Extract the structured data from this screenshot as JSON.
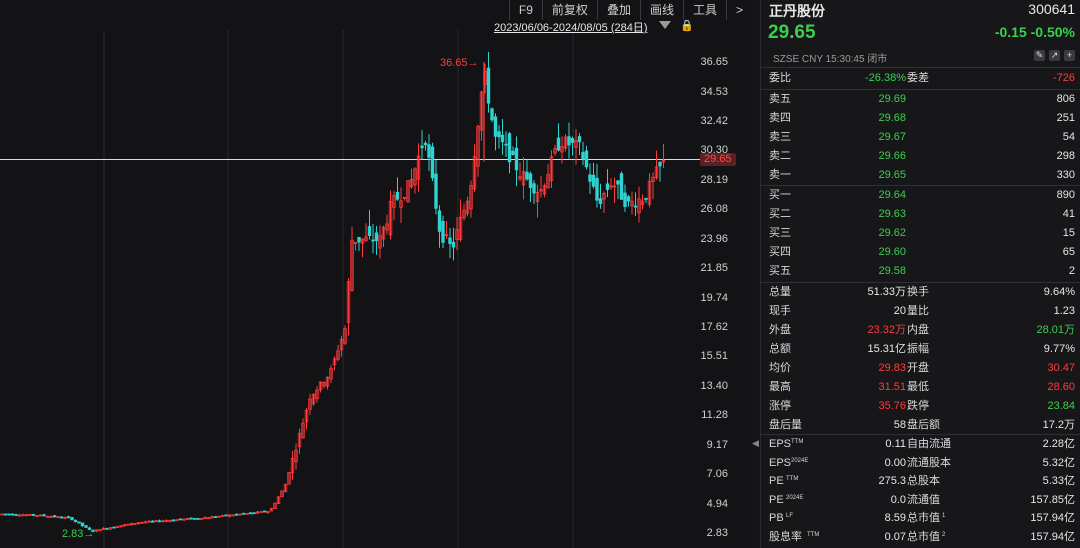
{
  "toolbar": {
    "items": [
      "F9",
      "前复权",
      "叠加",
      "画线",
      "工具",
      ">"
    ]
  },
  "range_label": "2023/06/06-2024/08/05 (284日)",
  "current_price_badge": "29.65",
  "max_label": "36.65",
  "min_label": "2.83",
  "chart_data": {
    "type": "candlestick",
    "title": "",
    "y_ticks": [
      "36.65",
      "34.53",
      "32.42",
      "30.30",
      "28.19",
      "26.08",
      "23.96",
      "21.85",
      "19.74",
      "17.62",
      "15.51",
      "13.40",
      "11.28",
      "9.17",
      "7.06",
      "4.94",
      "2.83"
    ],
    "ylim": [
      2.83,
      36.65
    ],
    "x_range": [
      "2023/06/06",
      "2024/08/05"
    ],
    "trading_days": 284,
    "max_marker": 36.65,
    "min_marker": 2.83,
    "current_price_line": 29.65,
    "colors": {
      "up": "#ff3b3b",
      "down": "#2fd3cf",
      "grid": "#2a2a30",
      "price_line": "#dcdcdc"
    }
  },
  "stock": {
    "name": "正丹股份",
    "code": "300641",
    "price": "29.65",
    "change": "-0.15",
    "change_pct": "-0.50%",
    "meta": "SZSE  CNY  15:30:45  闭市"
  },
  "committee": {
    "l1": "委比",
    "v1": "-26.38%",
    "l2": "委差",
    "v2": "-726"
  },
  "asks": [
    {
      "label": "卖五",
      "price": "29.69",
      "vol": "806"
    },
    {
      "label": "卖四",
      "price": "29.68",
      "vol": "251"
    },
    {
      "label": "卖三",
      "price": "29.67",
      "vol": "54"
    },
    {
      "label": "卖二",
      "price": "29.66",
      "vol": "298"
    },
    {
      "label": "卖一",
      "price": "29.65",
      "vol": "330"
    }
  ],
  "bids": [
    {
      "label": "买一",
      "price": "29.64",
      "vol": "890"
    },
    {
      "label": "买二",
      "price": "29.63",
      "vol": "41"
    },
    {
      "label": "买三",
      "price": "29.62",
      "vol": "15"
    },
    {
      "label": "买四",
      "price": "29.60",
      "vol": "65"
    },
    {
      "label": "买五",
      "price": "29.58",
      "vol": "2"
    }
  ],
  "stats": [
    {
      "l1": "总量",
      "v1": "51.33万",
      "c1": "white",
      "l2": "换手",
      "v2": "9.64%",
      "c2": "white"
    },
    {
      "l1": "现手",
      "v1": "20",
      "c1": "white",
      "l2": "量比",
      "v2": "1.23",
      "c2": "white"
    },
    {
      "l1": "外盘",
      "v1": "23.32万",
      "c1": "red",
      "l2": "内盘",
      "v2": "28.01万",
      "c2": "green"
    },
    {
      "l1": "总额",
      "v1": "15.31亿",
      "c1": "white",
      "l2": "振幅",
      "v2": "9.77%",
      "c2": "white"
    },
    {
      "l1": "均价",
      "v1": "29.83",
      "c1": "red",
      "l2": "开盘",
      "v2": "30.47",
      "c2": "red"
    },
    {
      "l1": "最高",
      "v1": "31.51",
      "c1": "red",
      "l2": "最低",
      "v2": "28.60",
      "c2": "red"
    },
    {
      "l1": "涨停",
      "v1": "35.76",
      "c1": "red",
      "l2": "跌停",
      "v2": "23.84",
      "c2": "green"
    },
    {
      "l1": "盘后量",
      "v1": "58",
      "c1": "white",
      "l2": "盘后额",
      "v2": "17.2万",
      "c2": "white"
    }
  ],
  "fundamentals": [
    {
      "l1": "EPS",
      "sup": "TTM",
      "v1": "0.11",
      "l2": "自由流通",
      "sup2": "",
      "v2": "2.28亿"
    },
    {
      "l1": "EPS",
      "sup": "2024E",
      "v1": "0.00",
      "l2": "流通股本",
      "sup2": "",
      "v2": "5.32亿"
    },
    {
      "l1": "PE",
      "sup": "TTM",
      "v1": "275.3",
      "l2": "总股本",
      "sup2": "",
      "v2": "5.33亿"
    },
    {
      "l1": "PE",
      "sup": "2024E",
      "v1": "0.0",
      "l2": "流通值",
      "sup2": "",
      "v2": "157.85亿"
    },
    {
      "l1": "PB",
      "sup": "LF",
      "v1": "8.59",
      "l2": "总市值",
      "sup2": "1",
      "v2": "157.94亿"
    },
    {
      "l1": "股息率",
      "sup": "TTM",
      "v1": "0.07",
      "l2": "总市值",
      "sup2": "2",
      "v2": "157.94亿"
    }
  ]
}
